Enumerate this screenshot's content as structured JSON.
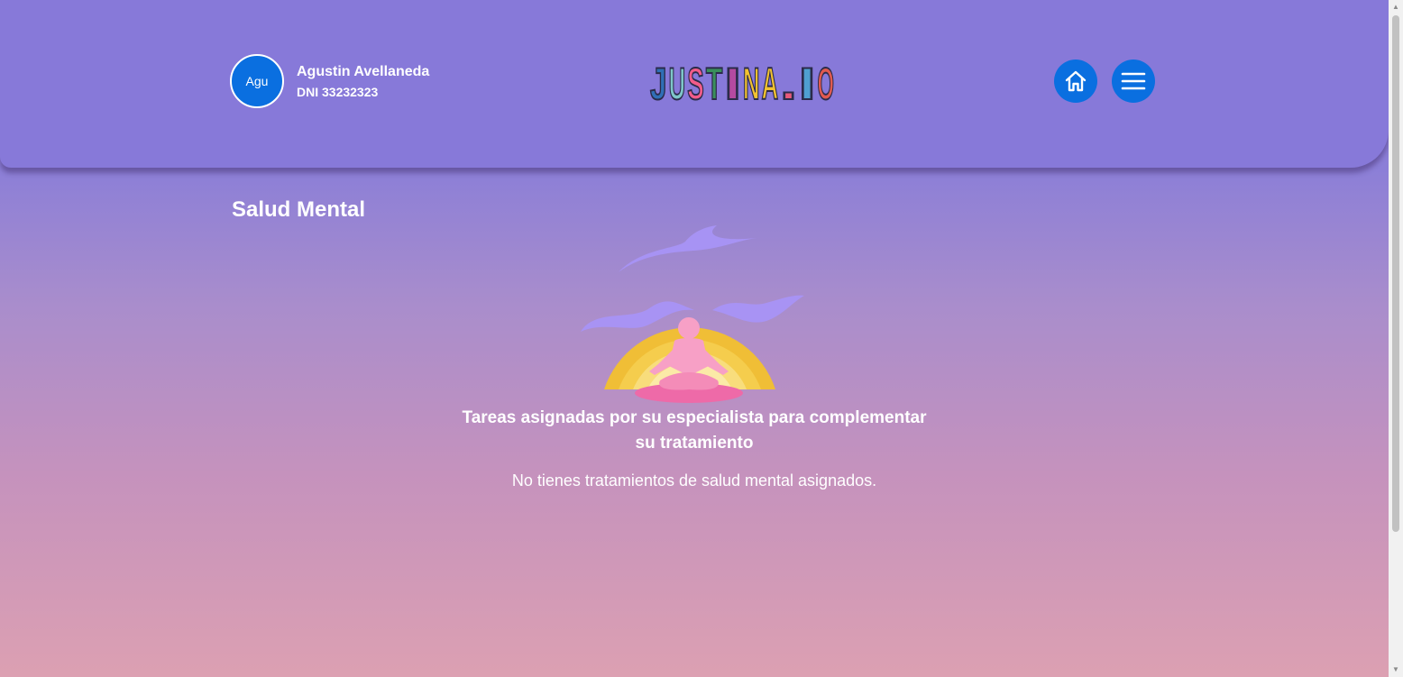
{
  "user": {
    "avatar_initials": "Agu",
    "name": "Agustin Avellaneda",
    "dni": "DNI 33232323"
  },
  "brand": {
    "logo_text": "JUSTINA.IO",
    "logo_letter_colors": [
      "#2f6fb6",
      "#7ec6c9",
      "#f25c8a",
      "#3a8f5c",
      "#b44aa0",
      "#f2c230",
      "#f2c230",
      "#e85a7a",
      "#4f9fd1",
      "#e05a50"
    ]
  },
  "nav": {
    "home_icon": "home-icon",
    "menu_icon": "hamburger-menu-icon"
  },
  "main": {
    "title": "Salud Mental",
    "tasks_heading": "Tareas asignadas por su especialista para complementar su tratamiento",
    "empty_message": "No tienes tratamientos de salud mental asignados."
  },
  "colors": {
    "header_bg": "#8779d9",
    "accent_blue": "#0a6fe0",
    "sun_yellow": "#f0be36",
    "figure_pink": "#f7a0c6",
    "wave_purple": "#a894f5"
  }
}
